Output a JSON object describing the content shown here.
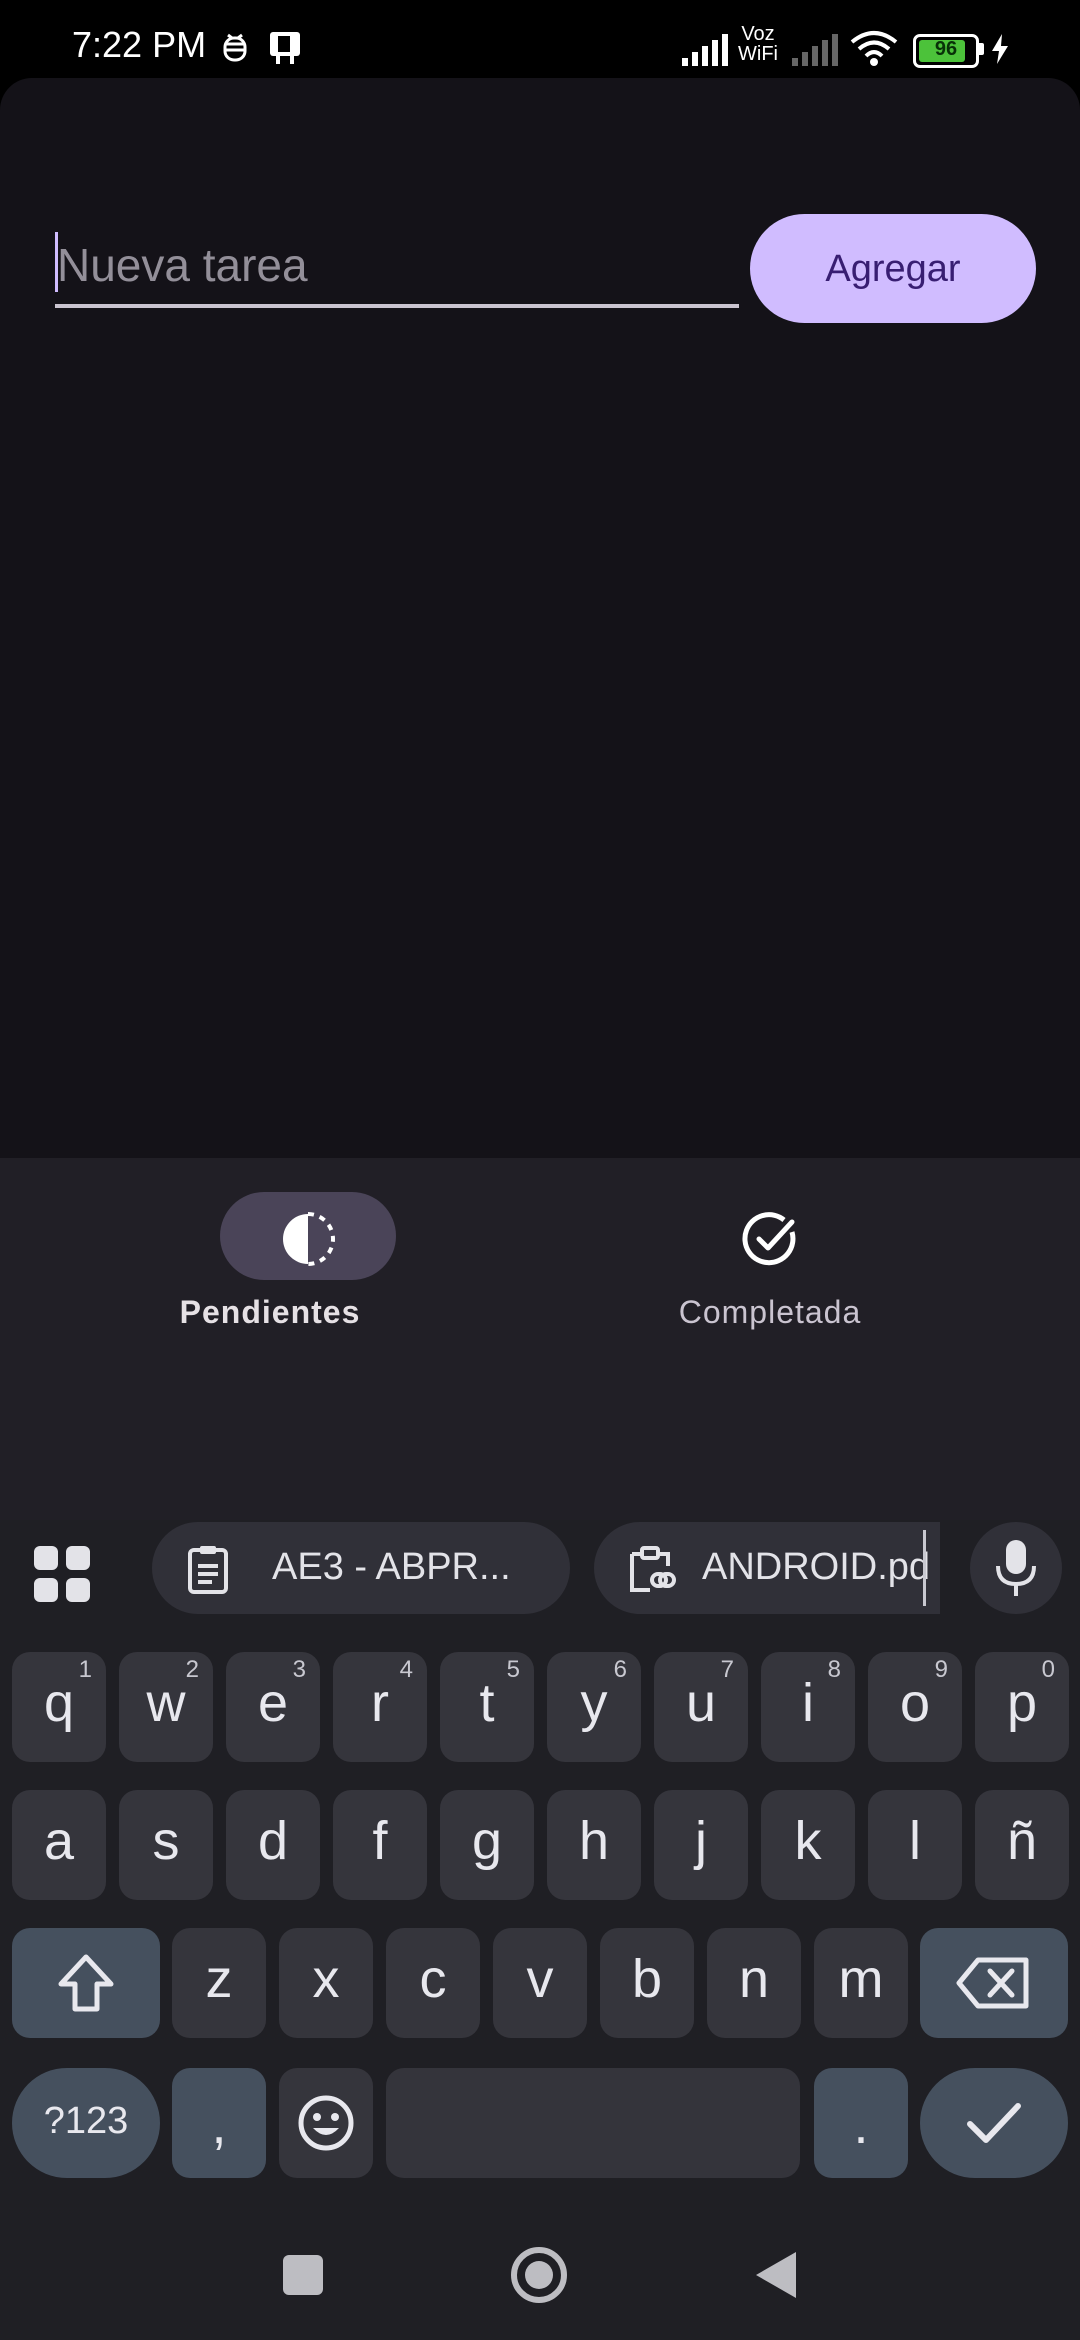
{
  "status_bar": {
    "time": "7:22 PM",
    "voz_line1": "Voz",
    "voz_line2": "WiFi",
    "battery": "96",
    "battery_level": 0.96
  },
  "task_form": {
    "placeholder": "Nueva tarea",
    "add_label": "Agregar"
  },
  "bottom_nav": {
    "items": [
      {
        "label": "Pendientes",
        "icon": "half-circle-icon",
        "selected": true
      },
      {
        "label": "Completada",
        "icon": "check-circle-icon",
        "selected": false
      }
    ]
  },
  "keyboard": {
    "suggestions": [
      {
        "label": "AE3 - ABPR...",
        "icon": "clipboard-icon"
      },
      {
        "label": "ANDROID.pd",
        "icon": "clipboard-link-icon"
      }
    ],
    "row1": [
      {
        "key": "q",
        "sup": "1"
      },
      {
        "key": "w",
        "sup": "2"
      },
      {
        "key": "e",
        "sup": "3"
      },
      {
        "key": "r",
        "sup": "4"
      },
      {
        "key": "t",
        "sup": "5"
      },
      {
        "key": "y",
        "sup": "6"
      },
      {
        "key": "u",
        "sup": "7"
      },
      {
        "key": "i",
        "sup": "8"
      },
      {
        "key": "o",
        "sup": "9"
      },
      {
        "key": "p",
        "sup": "0"
      }
    ],
    "row2": [
      "a",
      "s",
      "d",
      "f",
      "g",
      "h",
      "j",
      "k",
      "l",
      "ñ"
    ],
    "row3": [
      "z",
      "x",
      "c",
      "v",
      "b",
      "n",
      "m"
    ],
    "symbols_label": "?123",
    "comma": ",",
    "period": "."
  },
  "colors": {
    "accent": "#d0bcff",
    "on_accent": "#381e72",
    "background": "#141218",
    "nav_background": "#211f26",
    "selected_pill": "#4a4458"
  }
}
